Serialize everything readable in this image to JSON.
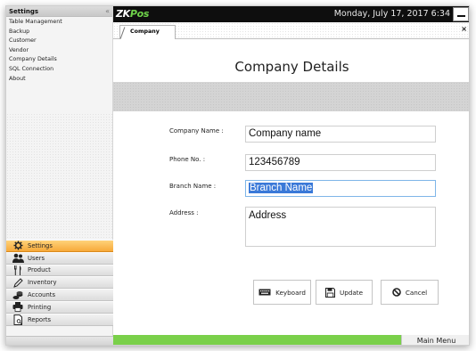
{
  "sidebar": {
    "title": "Settings",
    "collapse_glyph": "«",
    "items": [
      {
        "label": "Table Management"
      },
      {
        "label": "Backup"
      },
      {
        "label": "Customer"
      },
      {
        "label": "Vendor"
      },
      {
        "label": "Company Details"
      },
      {
        "label": "SQL Connection"
      },
      {
        "label": "About"
      }
    ],
    "active_nav": "Settings"
  },
  "nav": {
    "settings": "Settings",
    "users": "Users",
    "product": "Product",
    "inventory": "Inventory",
    "accounts": "Accounts",
    "printing": "Printing",
    "reports": "Reports"
  },
  "header": {
    "logo_zk": "ZK",
    "logo_pos": "Pos",
    "datetime": "Monday, July 17, 2017 6:34"
  },
  "tab": {
    "label": "Company",
    "close_glyph": "×"
  },
  "page": {
    "title": "Company Details"
  },
  "form": {
    "company_name_label": "Company Name :",
    "company_name_value": "Company name",
    "phone_label": "Phone No. :",
    "phone_value": "123456789",
    "branch_label": "Branch Name :",
    "branch_value": "Branch Name",
    "address_label": "Address :",
    "address_value": "Address"
  },
  "buttons": {
    "keyboard": "Keyboard",
    "update": "Update",
    "cancel": "Cancel"
  },
  "footer": {
    "main_menu": "Main Menu"
  },
  "colors": {
    "accent_green": "#7ad04a",
    "active_nav": "#f7a93a",
    "selection": "#3a79d8"
  }
}
